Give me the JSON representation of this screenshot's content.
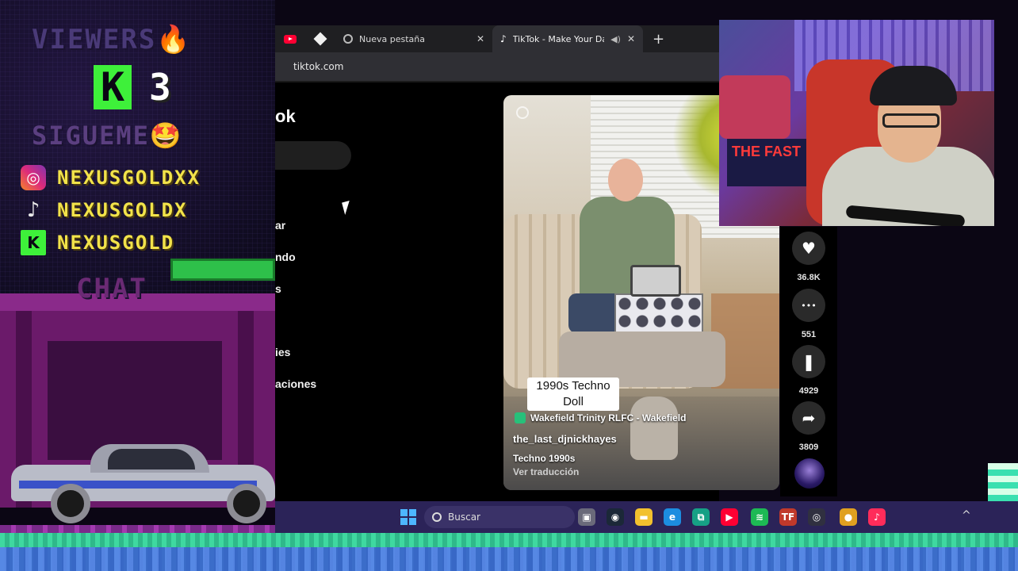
{
  "overlay": {
    "viewers_title": "VIEWERS🔥",
    "viewer_count": "3",
    "follow_title": "SIGUEME🤩",
    "socials": [
      {
        "platform_icon": "instagram-icon",
        "handle": "NEXUSGOLDXX"
      },
      {
        "platform_icon": "tiktok-icon",
        "handle": "NEXUSGOLDX"
      },
      {
        "platform_icon": "kick-icon",
        "handle": "NEXUSGOLD"
      }
    ],
    "chat_title": "CHAT",
    "kick_letter": "K"
  },
  "browser": {
    "tabs": [
      {
        "label": "Nueva pestaña",
        "icon": "chrome-icon",
        "active": false
      },
      {
        "label": "TikTok - Make Your Day",
        "icon": "tiktok-icon",
        "active": true
      }
    ],
    "close_glyph": "✕",
    "new_tab_glyph": "+",
    "url": "tiktok.com"
  },
  "tiktok": {
    "logo_fragment": "ok",
    "sidebar_fragments": [
      "ar",
      "ndo",
      "s",
      "ies",
      "aciones"
    ],
    "video": {
      "caption": "1990s Techno Doll",
      "location": "Wakefield Trinity RLFC - Wakefield",
      "username": "the_last_djnickhayes",
      "description": "Techno 1990s",
      "translate_link": "Ver traducción"
    },
    "actions": [
      {
        "icon": "heart-icon",
        "glyph": "♥",
        "count": "36.8K"
      },
      {
        "icon": "comment-icon",
        "glyph": "•••",
        "count": "551"
      },
      {
        "icon": "bookmark-icon",
        "glyph": "❚",
        "count": "4929"
      },
      {
        "icon": "share-icon",
        "glyph": "➦",
        "count": "3809"
      }
    ]
  },
  "taskbar": {
    "search_placeholder": "Buscar",
    "pinned": [
      {
        "name": "task-view-icon",
        "glyph": "▣",
        "color": "#6a6a7a"
      },
      {
        "name": "steam-icon",
        "glyph": "◉",
        "color": "#1b2838"
      },
      {
        "name": "file-explorer-icon",
        "glyph": "▬",
        "color": "#f2c12e"
      },
      {
        "name": "edge-icon",
        "glyph": "e",
        "color": "#1c8de0"
      },
      {
        "name": "phone-link-icon",
        "glyph": "⧉",
        "color": "#16a085"
      },
      {
        "name": "youtube-icon",
        "glyph": "▶",
        "color": "#ff0033"
      },
      {
        "name": "spotify-icon",
        "glyph": "≋",
        "color": "#1db954"
      },
      {
        "name": "tf-icon",
        "glyph": "TF",
        "color": "#c0392b"
      },
      {
        "name": "obs-icon",
        "glyph": "◎",
        "color": "#303040"
      },
      {
        "name": "chrome-icon",
        "glyph": "●",
        "color": "#e0a020"
      },
      {
        "name": "tiktok-icon",
        "glyph": "♪",
        "color": "#ff2c5a"
      }
    ],
    "tray_arrow": "^"
  },
  "webcam": {
    "poster_text": "THE FAST"
  }
}
